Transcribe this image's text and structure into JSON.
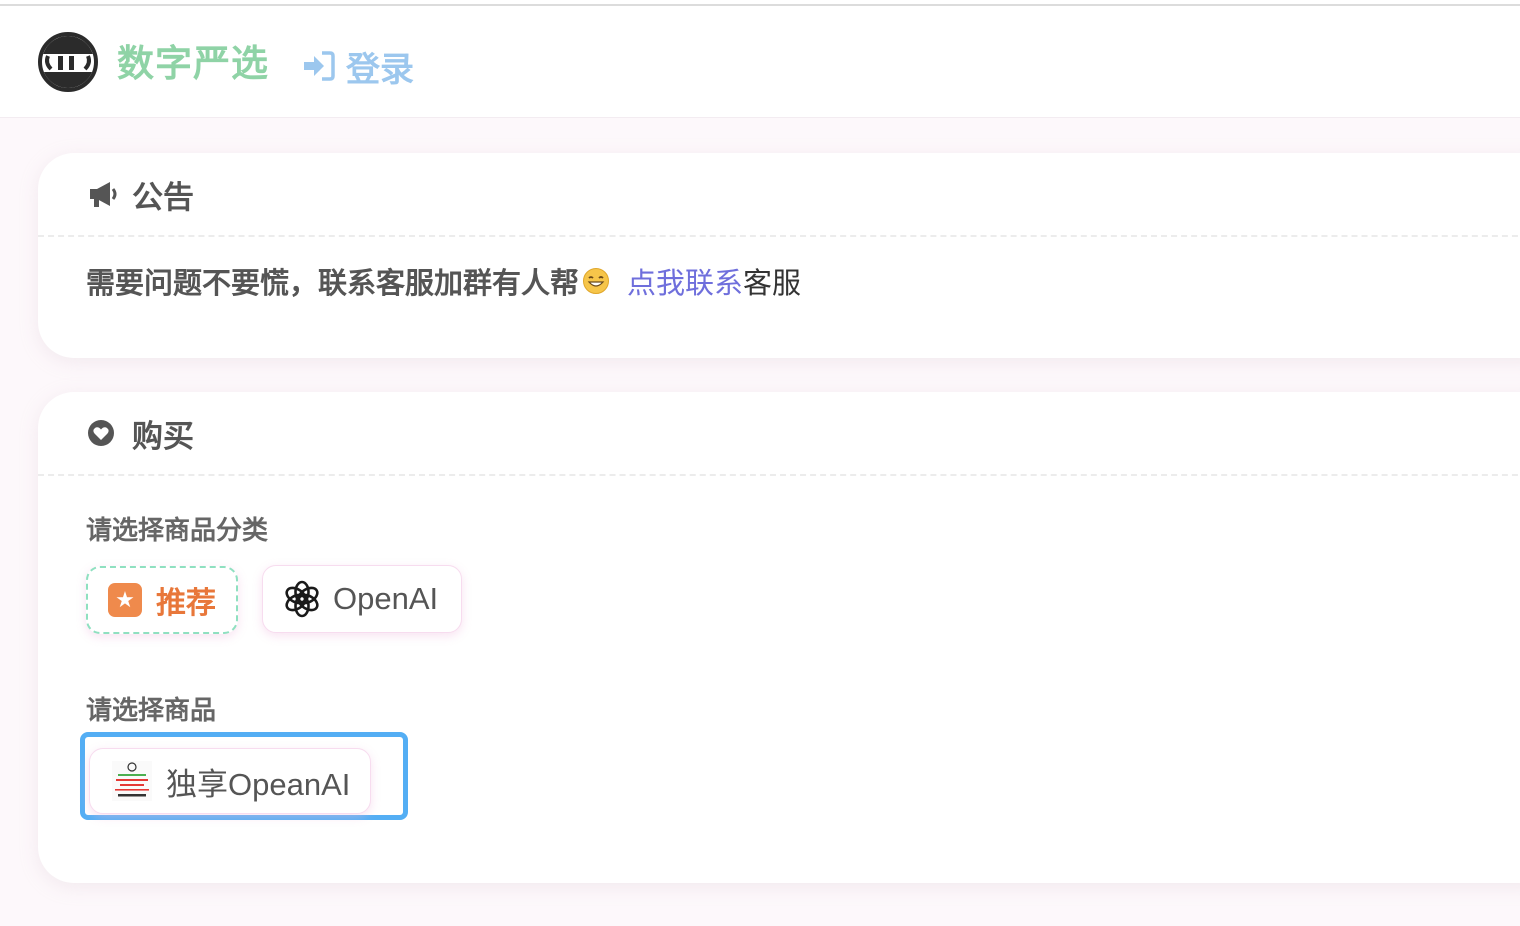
{
  "header": {
    "brand": "数字严选",
    "login_label": "登录"
  },
  "notice": {
    "title": "公告",
    "message": "需要问题不要慌，联系客服加群有人帮",
    "link_text": "点我联系",
    "tail_text": "客服"
  },
  "purchase": {
    "title": "购买",
    "category_label": "请选择商品分类",
    "categories": [
      {
        "label": "推荐",
        "icon": "star-badge-icon"
      },
      {
        "label": "OpenAI",
        "icon": "openai-logo-icon"
      }
    ],
    "goods_label": "请选择商品",
    "goods": [
      {
        "label": "独享OpeanAI",
        "icon": "product-thumbnail"
      }
    ]
  },
  "colors": {
    "brand": "#8fd3a6",
    "login": "#9cc7ee",
    "link": "#6f6fdc",
    "recommend": "#e8773a",
    "selected_border": "#54aef4"
  }
}
